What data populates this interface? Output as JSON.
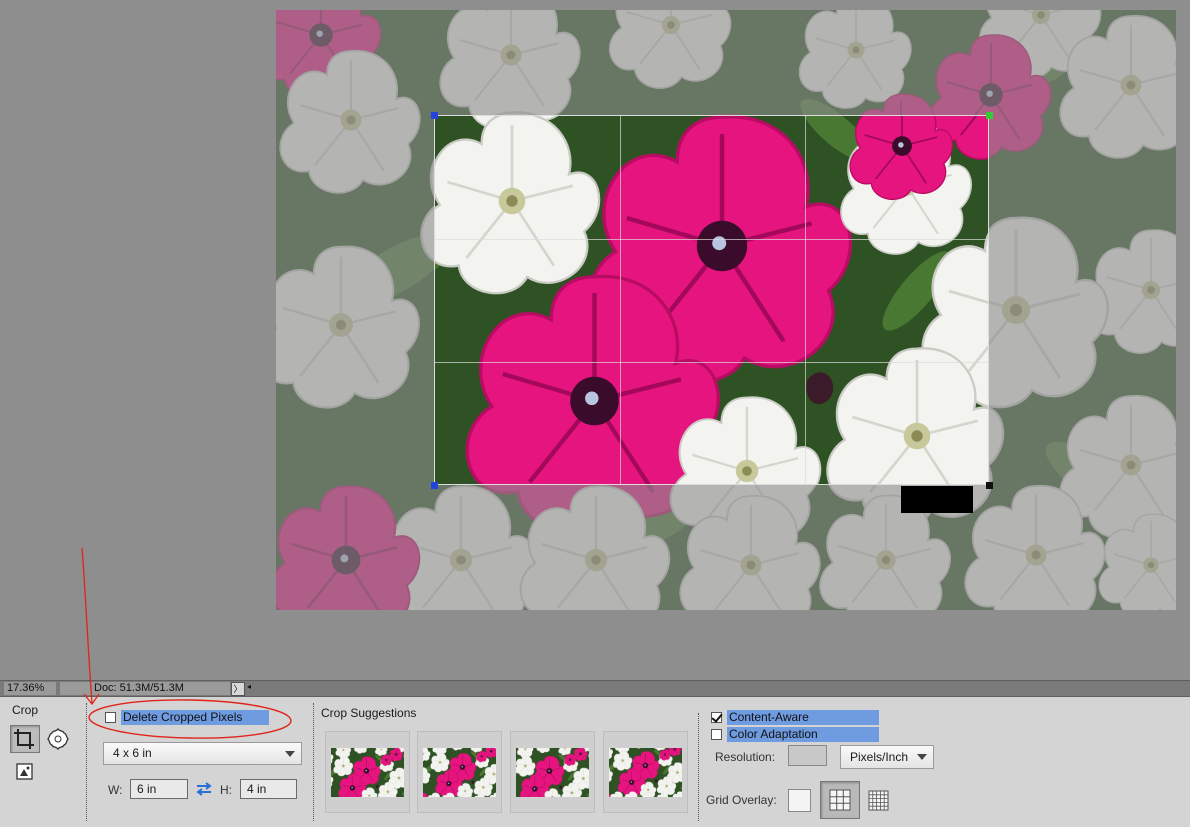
{
  "status_bar": {
    "zoom": "17.36%",
    "doc_info": "Doc: 51.3M/51.3M",
    "arrow": "〉",
    "scroll_arrow": "◂"
  },
  "options": {
    "tool_name": "Crop",
    "delete_cropped_pixels": {
      "label": "Delete Cropped Pixels",
      "checked": false
    },
    "aspect_preset": "4 x 6 in",
    "width_label": "W:",
    "width_value": "6 in",
    "height_label": "H:",
    "height_value": "4 in",
    "suggestions_title": "Crop Suggestions",
    "content_aware": {
      "label": "Content-Aware",
      "checked": true
    },
    "color_adaptation": {
      "label": "Color Adaptation",
      "checked": false
    },
    "resolution_label": "Resolution:",
    "resolution_value": "",
    "resolution_units": "Pixels/Inch",
    "grid_overlay_label": "Grid Overlay:",
    "grid_overlay_selected": "rule-of-thirds"
  },
  "colors": {
    "canvas_bg": "#8e8e8e",
    "panel_bg": "#d4d4d4",
    "highlight": "#6f9be0",
    "annotation": "#e0241b",
    "petunia_pink": "#e6147e",
    "petunia_white": "#f2f2ef",
    "foliage": "#3e6a2c"
  },
  "icons": {
    "crop_tool": "crop-icon",
    "cookie_cutter": "cookie-cutter-icon",
    "perspective_crop": "perspective-crop-icon",
    "swap": "swap-arrows-icon",
    "grid_none": "grid-none-icon",
    "grid_thirds": "grid-thirds-icon",
    "grid_fine": "grid-fine-icon"
  }
}
